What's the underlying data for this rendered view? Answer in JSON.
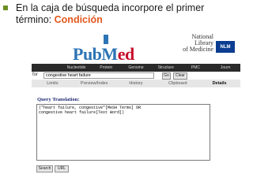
{
  "slide": {
    "line1": "En la caja de búsqueda  incorpore el  primer",
    "line2_prefix": "término: ",
    "line2_highlight": "Condición"
  },
  "logo": {
    "pub": "Pub",
    "m": "M",
    "ed": "ed"
  },
  "nlm": {
    "line1": "National",
    "line2": "Library",
    "line3": "of Medicine",
    "badge": "NLM"
  },
  "databases": [
    "",
    "Nucleotide",
    "Protein",
    "Genome",
    "Structure",
    "PMC",
    "Journ"
  ],
  "search": {
    "label": "for",
    "value": "congestive heart failure",
    "go_label": "Go",
    "clear_label": "Clear"
  },
  "tabs": [
    "Limits",
    "Preview/Index",
    "History",
    "Clipboard",
    "Details"
  ],
  "query": {
    "title": "Query Translation:",
    "text": "(\"heart failure, congestive\"[MeSH Terms] OR\ncongestive heart failure[Text Word])",
    "search_label": "Search",
    "url_label": "URL"
  }
}
